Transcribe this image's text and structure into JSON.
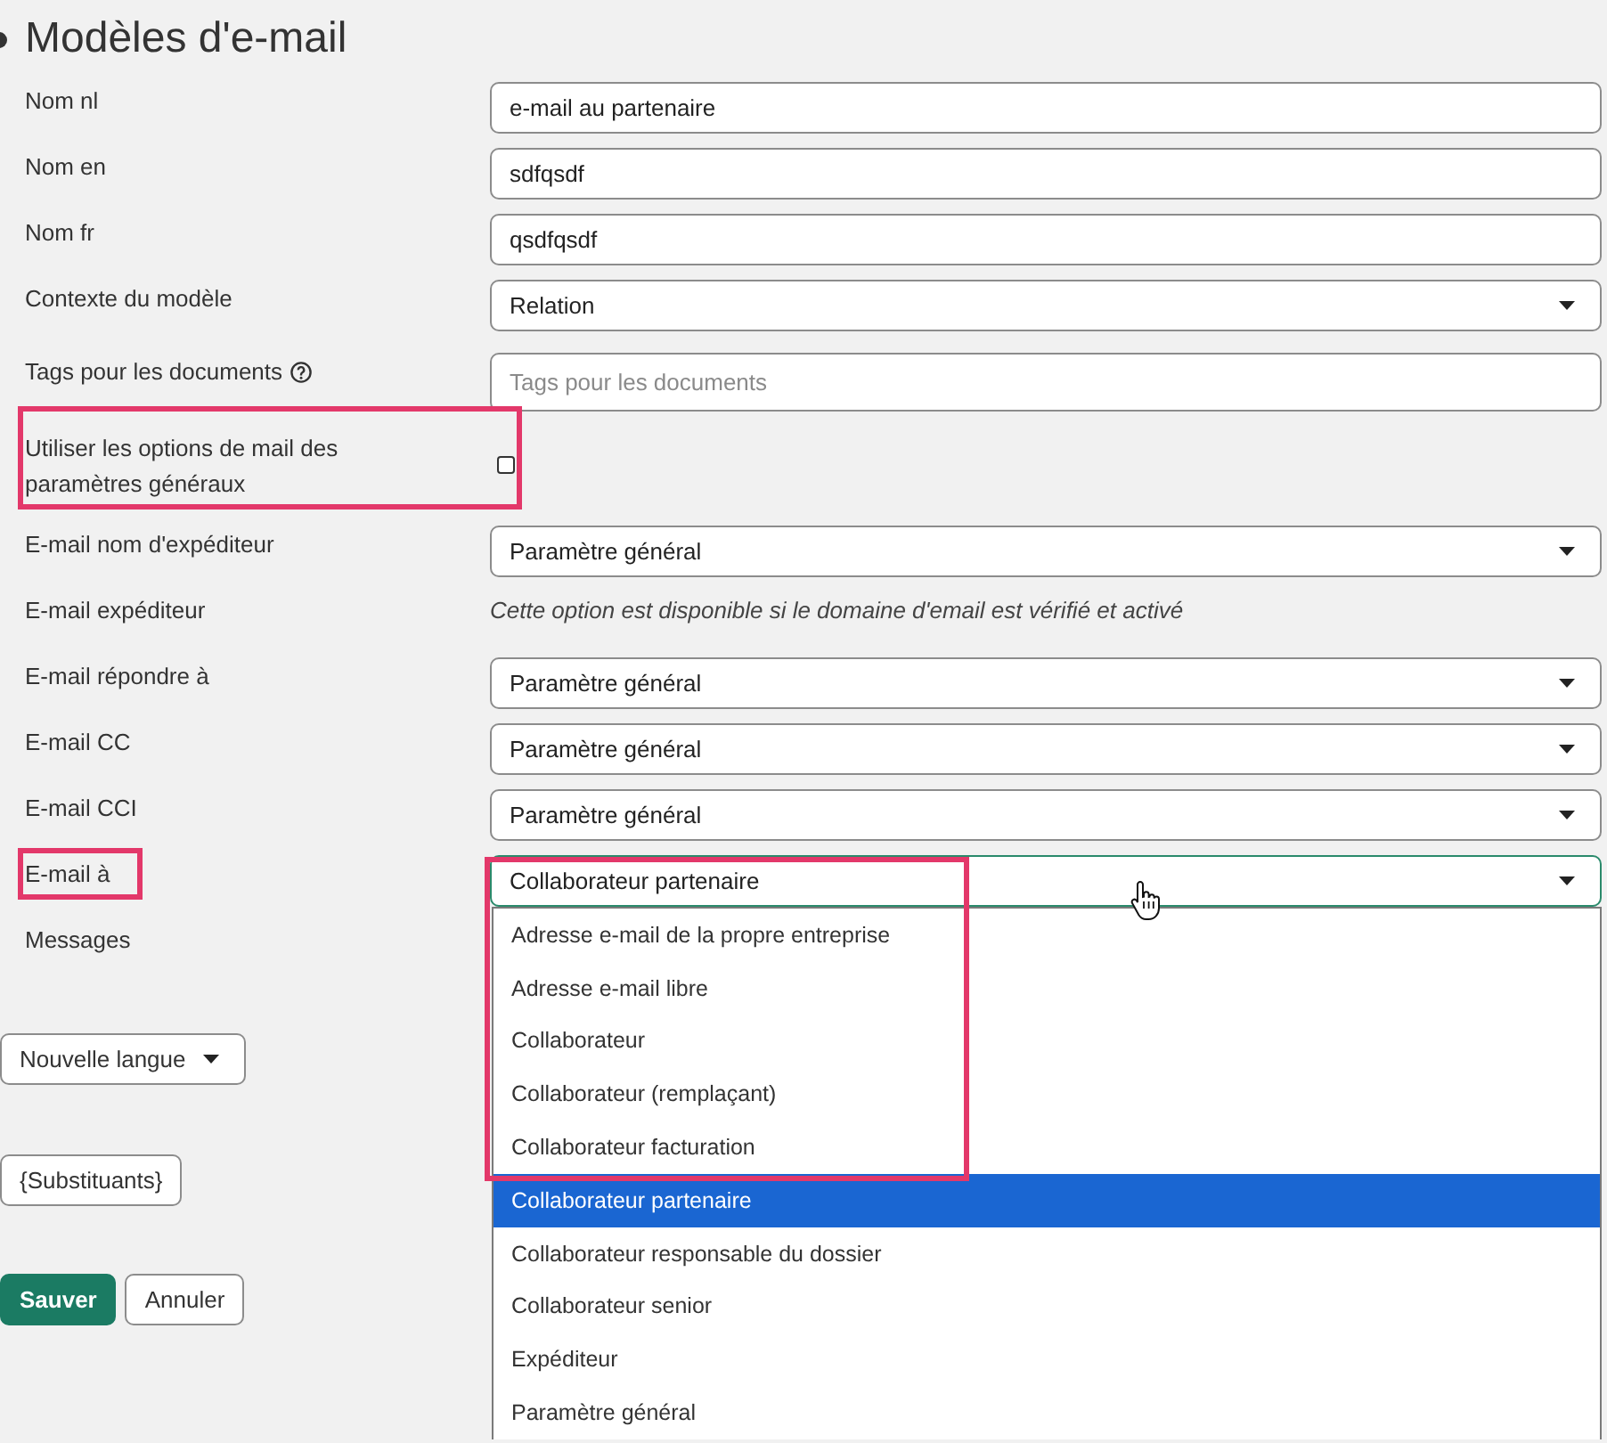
{
  "page": {
    "title": "Modèles d'e-mail"
  },
  "fields": [
    {
      "kind": "text",
      "label": "Nom nl",
      "value": "e-mail au partenaire"
    },
    {
      "kind": "text",
      "label": "Nom en",
      "value": "sdfqsdf"
    },
    {
      "kind": "text",
      "label": "Nom fr",
      "value": "qsdfqsdf"
    },
    {
      "kind": "select",
      "label": "Contexte du modèle",
      "value": "Relation"
    },
    {
      "kind": "tags",
      "label": "Tags pour les documents",
      "help": true,
      "placeholder": "Tags pour les documents"
    },
    {
      "kind": "checkbox",
      "label": "Utiliser les options de mail des paramètres généraux",
      "checked": false,
      "highlighted": true
    },
    {
      "kind": "select",
      "label": "E-mail nom d'expéditeur",
      "value": "Paramètre général"
    },
    {
      "kind": "note",
      "label": "E-mail expéditeur",
      "note": "Cette option est disponible si le domaine d'email est vérifié et activé"
    },
    {
      "kind": "select",
      "label": "E-mail répondre à",
      "value": "Paramètre général"
    },
    {
      "kind": "select",
      "label": "E-mail CC",
      "value": "Paramètre général"
    },
    {
      "kind": "select",
      "label": "E-mail CCI",
      "value": "Paramètre général"
    },
    {
      "kind": "select",
      "label": "E-mail à",
      "value": "Collaborateur partenaire",
      "focused": true,
      "expanded": true,
      "label_highlighted": true,
      "value_highlighted": true,
      "options": [
        {
          "label": "Adresse e-mail de la propre entreprise",
          "selected": false,
          "highlighted": true
        },
        {
          "label": "Adresse e-mail libre",
          "selected": false,
          "highlighted": true
        },
        {
          "label": "Collaborateur",
          "selected": false,
          "highlighted": true
        },
        {
          "label": "Collaborateur (remplaçant)",
          "selected": false,
          "highlighted": true
        },
        {
          "label": "Collaborateur facturation",
          "selected": false,
          "highlighted": true
        },
        {
          "label": "Collaborateur partenaire",
          "selected": true,
          "highlighted": false
        },
        {
          "label": "Collaborateur responsable du dossier",
          "selected": false,
          "highlighted": false
        },
        {
          "label": "Collaborateur senior",
          "selected": false,
          "highlighted": false
        },
        {
          "label": "Expéditeur",
          "selected": false,
          "highlighted": false
        },
        {
          "label": "Paramètre général",
          "selected": false,
          "highlighted": false
        }
      ]
    },
    {
      "kind": "label",
      "label": "Messages"
    }
  ],
  "language_button": {
    "label": "Nouvelle langue"
  },
  "placeholders_button": {
    "label": "{Substituants}"
  },
  "actions": [
    {
      "kind": "primary",
      "label": "Sauver"
    },
    {
      "kind": "secondary",
      "label": "Annuler"
    }
  ]
}
